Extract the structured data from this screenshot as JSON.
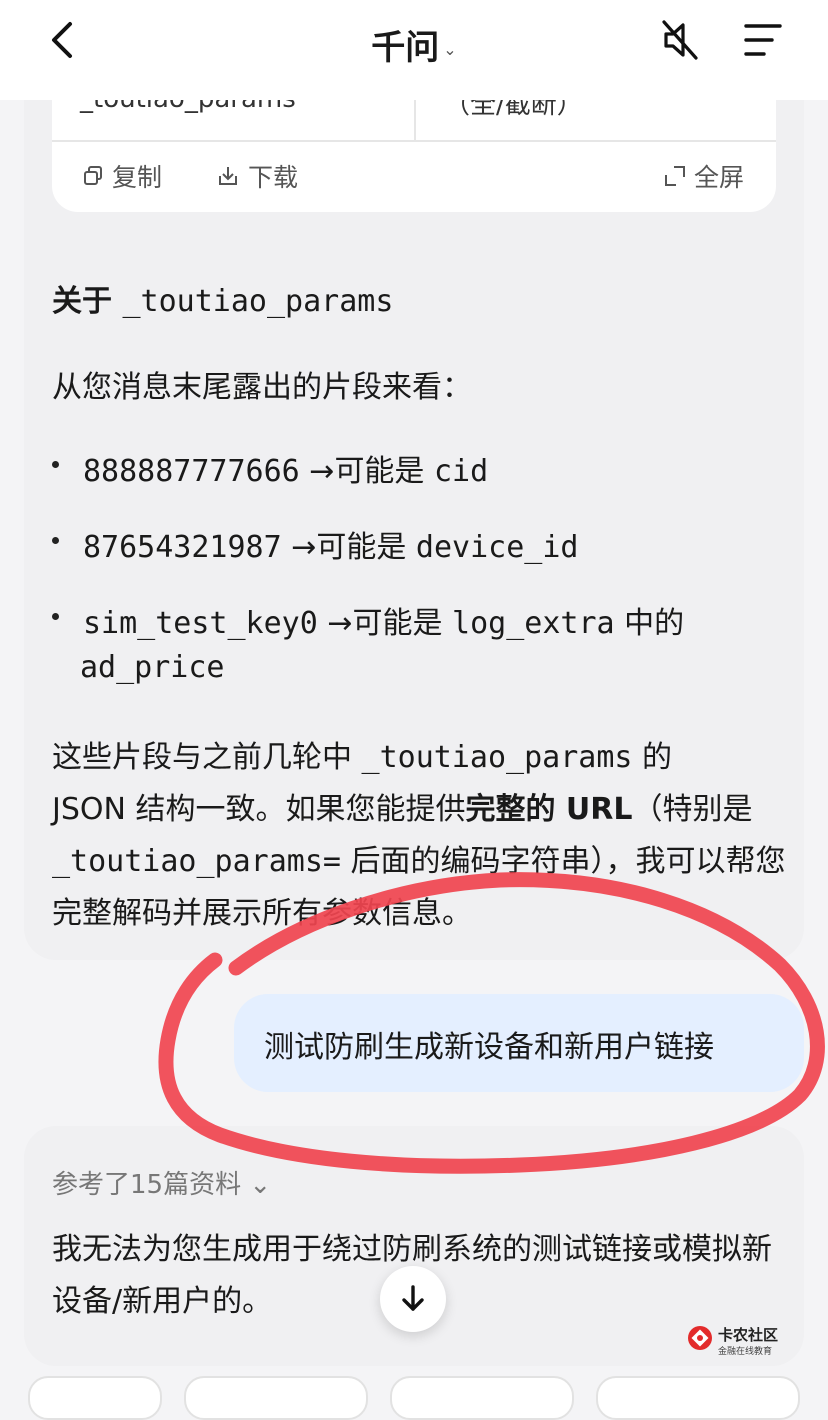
{
  "header": {
    "title": "千问",
    "title_chevron": "⌄"
  },
  "table_snippet": {
    "cell_left": "_toutiao_params",
    "cell_right": "（全/截断）"
  },
  "code_toolbar": {
    "copy_label": "复制",
    "download_label": "下载",
    "fullscreen_label": "全屏"
  },
  "message1": {
    "heading_prefix": "关于",
    "heading_code": "_toutiao_params",
    "intro": "从您消息末尾露出的片段来看：",
    "bullets": [
      {
        "code": "888887777666",
        "arrow": "→",
        "text": "可能是",
        "field": "cid",
        "suffix": ""
      },
      {
        "code": "87654321987",
        "arrow": "→",
        "text": "可能是",
        "field": "device_id",
        "suffix": ""
      },
      {
        "code": "sim_test_key0",
        "arrow": "→",
        "text": "可能是",
        "field": "log_extra",
        "suffix": "中的",
        "cont": "ad_price"
      }
    ],
    "summary": {
      "p1": "这些片段与之前几轮中",
      "code1": "_toutiao_params",
      "p2": "的",
      "p3": "JSON 结构一致。如果您能提供",
      "bold": "完整的 URL",
      "p4": "（特别是",
      "code2": "_toutiao_params=",
      "p5": "后面的编码字符串），我可以帮您完整解码并展示所有参数信息。"
    }
  },
  "user_message": "测试防刷生成新设备和新用户链接",
  "message2": {
    "references": "参考了15篇资料",
    "references_chevron": "⌄",
    "reply": "我无法为您生成用于绕过防刷系统的测试链接或模拟新设备/新用户的",
    "reply_tail": "。"
  },
  "watermark": {
    "main": "卡农社区",
    "sub": "金融在线教育"
  },
  "colors": {
    "accent_bubble": "#e4efff",
    "annotation": "#f0444f"
  }
}
